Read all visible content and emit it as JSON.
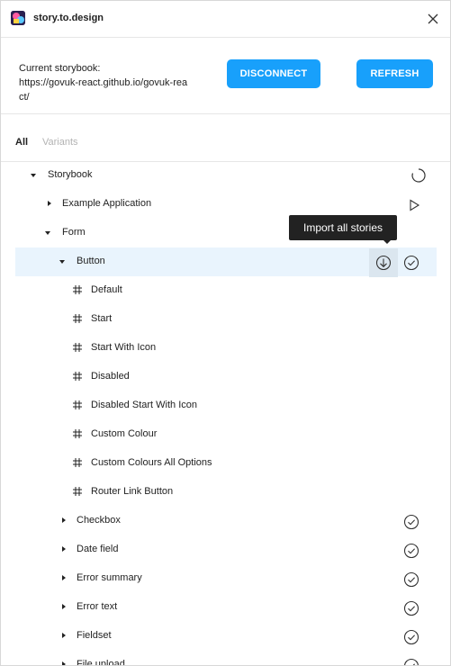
{
  "window": {
    "title": "story.to.design"
  },
  "header": {
    "storybook_label": "Current storybook:",
    "storybook_url": "https://govuk-react.github.io/govuk-react/",
    "disconnect_label": "DISCONNECT",
    "refresh_label": "REFRESH"
  },
  "tabs": {
    "all": "All",
    "variants": "Variants"
  },
  "tooltip": "Import all stories",
  "colors": {
    "accent": "#18a0fb",
    "selected_row": "#e9f4fd",
    "tooltip_bg": "#222222"
  },
  "tree": {
    "storybook": "Storybook",
    "example_application": "Example Application",
    "form": "Form",
    "button": "Button",
    "stories": [
      "Default",
      "Start",
      "Start With Icon",
      "Disabled",
      "Disabled Start With Icon",
      "Custom Colour",
      "Custom Colours All Options",
      "Router Link Button"
    ],
    "components": [
      "Checkbox",
      "Date field",
      "Error summary",
      "Error text",
      "Fieldset",
      "File upload"
    ]
  },
  "icons": {
    "storybook_status": "spinner-icon",
    "example_application_action": "play-icon",
    "button_import": "download-circle-icon",
    "imported": "check-circle-icon",
    "story": "hash-icon"
  }
}
